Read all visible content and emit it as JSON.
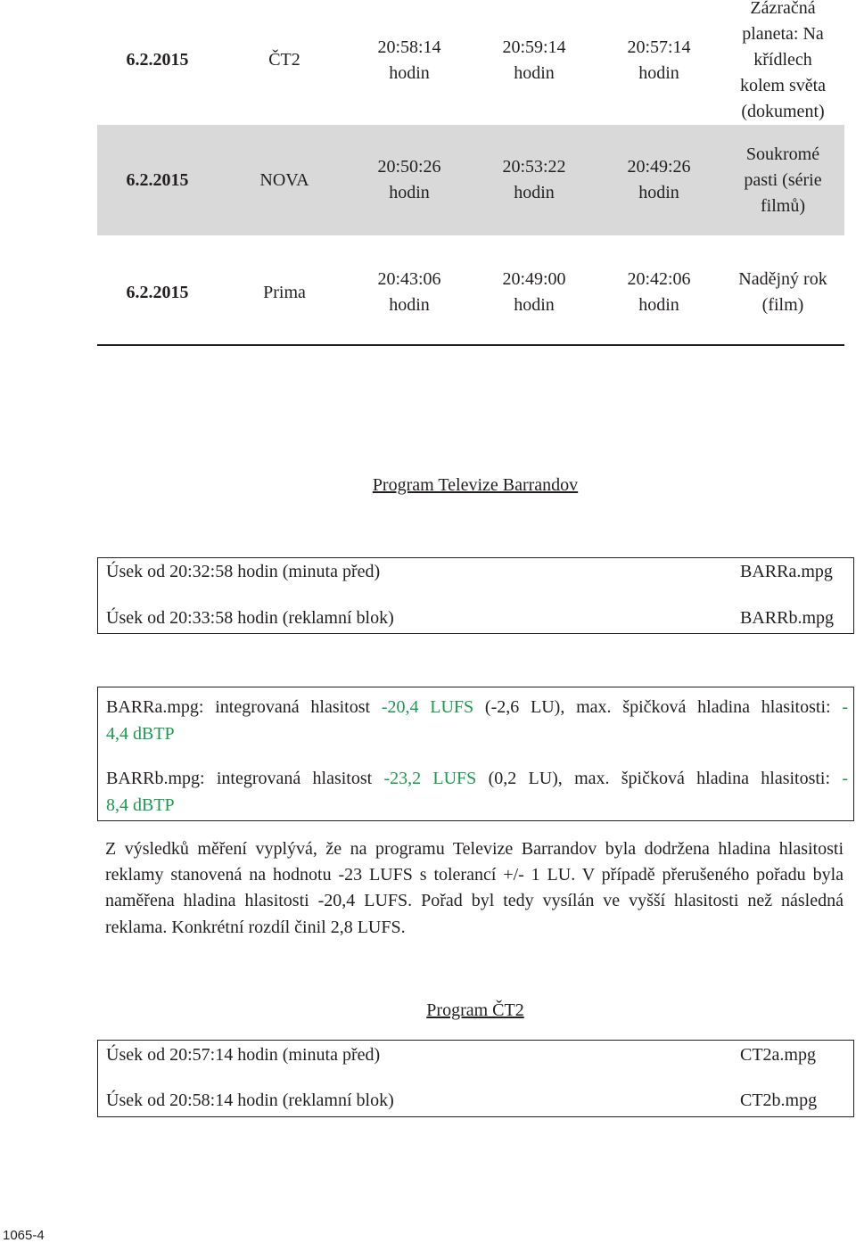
{
  "table_rows": [
    {
      "date": "6.2.2015",
      "channel": "ČT2",
      "t1": "20:58:14",
      "t2": "20:59:14",
      "t3": "20:57:14",
      "unit": "hodin",
      "program": [
        "Zázračná",
        "planeta: Na",
        "křídlech",
        "kolem světa",
        "(dokument)"
      ],
      "shaded": false
    },
    {
      "date": "6.2.2015",
      "channel": "NOVA",
      "t1": "20:50:26",
      "t2": "20:53:22",
      "t3": "20:49:26",
      "unit": "hodin",
      "program": [
        "Soukromé",
        "pasti (série",
        "filmů)"
      ],
      "shaded": true
    },
    {
      "date": "6.2.2015",
      "channel": "Prima",
      "t1": "20:43:06",
      "t2": "20:49:00",
      "t3": "20:42:06",
      "unit": "hodin",
      "program": [
        "Nadějný rok",
        "(film)"
      ],
      "shaded": false
    }
  ],
  "colors": {
    "row_shade": "#d9d9da",
    "loudness_green": "#1a9a4e",
    "text": "#231f20"
  },
  "barrandov": {
    "heading": "Program Televize Barrandov",
    "segments": [
      {
        "label": "Úsek od 20:32:58 hodin (minuta před)",
        "file": "BARRa.mpg"
      },
      {
        "label": "Úsek od 20:33:58 hodin (reklamní blok)",
        "file": "BARRb.mpg"
      }
    ],
    "results": [
      {
        "prefix": "BARRa.mpg: integrovaná hlasitost ",
        "lufs": "-20,4 LUFS",
        "middle": " (-2,6 LU), max. špičková hladina hlasitosti: ",
        "dash": "-",
        "peak": "4,4 dBTP"
      },
      {
        "prefix": "BARRb.mpg: integrovaná hlasitost ",
        "lufs": "-23,2 LUFS",
        "middle": " (0,2 LU), max. špičková hladina hlasitosti: ",
        "dash": "-",
        "peak": "8,4 dBTP"
      }
    ],
    "conclusion": "Z výsledků měření vyplývá, že na programu Televize Barrandov byla dodržena hladina hlasitosti reklamy stanovená na hodnotu -23 LUFS s tolerancí +/- 1 LU. V případě přerušeného pořadu byla naměřena hladina hlasitosti -20,4 LUFS. Pořad byl tedy vysílán ve vyšší hlasitosti než následná reklama. Konkrétní rozdíl činil 2,8 LUFS."
  },
  "ct2": {
    "heading": "Program ČT2",
    "segments": [
      {
        "label": "Úsek od 20:57:14 hodin (minuta před)",
        "file": "CT2a.mpg"
      },
      {
        "label": "Úsek od 20:58:14 hodin (reklamní blok)",
        "file": "CT2b.mpg"
      }
    ]
  },
  "footer": "1065-4"
}
